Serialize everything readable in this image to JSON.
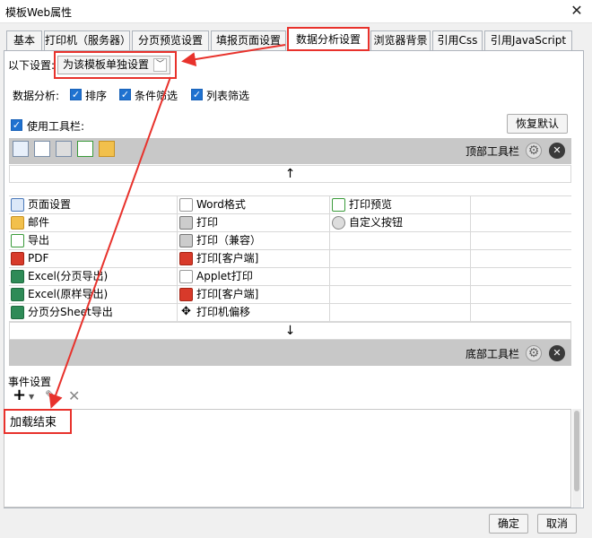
{
  "window": {
    "title": "模板Web属性",
    "close_icon": "close-icon"
  },
  "tabs": [
    {
      "label": "基本"
    },
    {
      "label": "打印机（服务器）"
    },
    {
      "label": "分页预览设置"
    },
    {
      "label": "填报页面设置"
    },
    {
      "label": "数据分析设置"
    },
    {
      "label": "浏览器背景"
    },
    {
      "label": "引用Css"
    },
    {
      "label": "引用JavaScript"
    }
  ],
  "settings": {
    "label": "以下设置:",
    "select_value": "为该模板单独设置"
  },
  "analysis": {
    "label": "数据分析:",
    "options": [
      {
        "label": "排序",
        "checked": true
      },
      {
        "label": "条件筛选",
        "checked": true
      },
      {
        "label": "列表筛选",
        "checked": true
      }
    ]
  },
  "toolbar_section": {
    "use_toolbar_label": "使用工具栏:",
    "restore_default": "恢复默认",
    "top_label": "顶部工具栏",
    "bottom_label": "底部工具栏"
  },
  "grid": {
    "col1": [
      "页面设置",
      "邮件",
      "导出",
      "PDF",
      "Excel(分页导出)",
      "Excel(原样导出)",
      "分页分Sheet导出"
    ],
    "col2": [
      "Word格式",
      "打印",
      "打印（兼容）",
      "打印[客户端]",
      "Applet打印",
      "打印[客户端]",
      "打印机偏移"
    ],
    "col3": [
      "打印预览",
      "自定义按钮"
    ]
  },
  "events": {
    "label": "事件设置",
    "add_icon": "add-icon",
    "edit_icon": "edit-icon",
    "delete_icon": "delete-icon",
    "item": "加载结束"
  },
  "footer": {
    "ok": "确定",
    "cancel": "取消"
  },
  "colors": {
    "highlight": "#e8322c",
    "checkbox": "#1f72d0",
    "bar": "#c8c8c8"
  }
}
